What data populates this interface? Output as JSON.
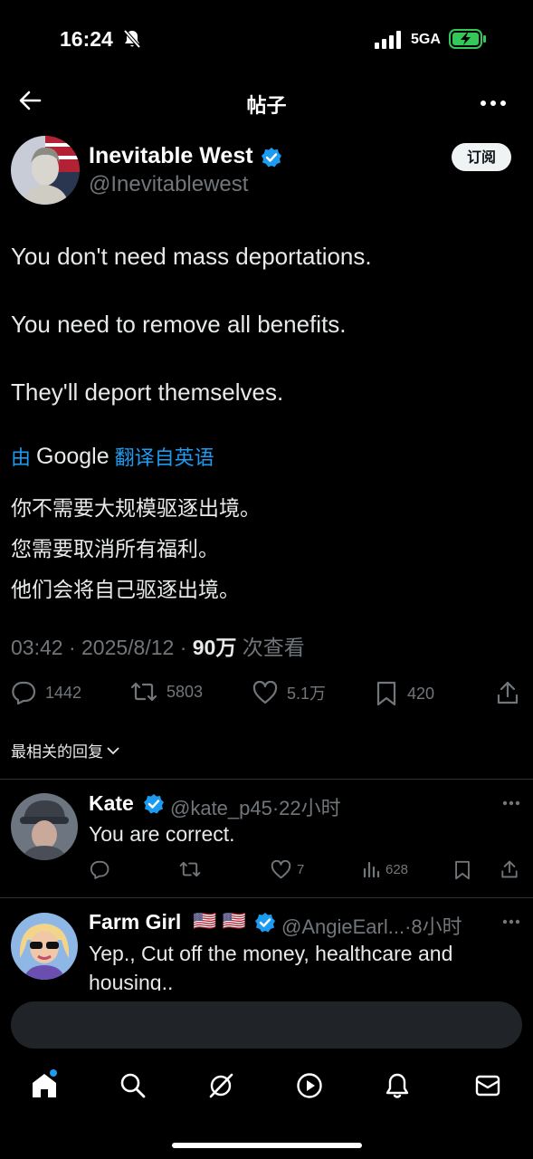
{
  "status_bar": {
    "time": "16:24",
    "network": "5GA"
  },
  "header": {
    "title": "帖子"
  },
  "post": {
    "author_name": "Inevitable West",
    "author_handle": "@Inevitablewest",
    "subscribe_label": "订阅",
    "lines": [
      "You don't need mass deportations.",
      "You need to remove all benefits.",
      "They'll deport themselves."
    ],
    "translation": {
      "prefix": "由",
      "provider": "Google",
      "suffix": "翻译自英语",
      "lines": [
        "你不需要大规模驱逐出境。",
        "您需要取消所有福利。",
        "他们会将自己驱逐出境。"
      ]
    },
    "time": "03:42 · 2025/8/12 · ",
    "views": "90万",
    "views_label": " 次查看",
    "stats": {
      "replies": "1442",
      "reposts": "5803",
      "likes": "5.1万",
      "bookmarks": "420"
    }
  },
  "replies_sort": "最相关的回复",
  "replies": [
    {
      "name": "Kate",
      "handle": "@kate_p45",
      "time": "·22小时",
      "text": "You are correct.",
      "likes": "7",
      "views": "628"
    },
    {
      "name": "Farm Girl",
      "flags": "🇺🇸 🇺🇸",
      "handle": "@AngieEarl...",
      "time": "·8小时",
      "text_lines": [
        "Yep., Cut off the money, healthcare and",
        "housing.."
      ]
    }
  ],
  "composer": {
    "placeholder": ""
  },
  "colors": {
    "accent": "#1d9bf0",
    "background": "#000000",
    "secondary_text": "#71767b",
    "battery": "#34c759"
  },
  "icons": [
    "back-arrow-icon",
    "more-icon",
    "verified-icon",
    "reply-icon",
    "repost-icon",
    "like-icon",
    "bookmark-icon",
    "share-icon",
    "views-icon",
    "home-icon",
    "search-icon",
    "grok-icon",
    "video-icon",
    "notifications-icon",
    "messages-icon"
  ]
}
